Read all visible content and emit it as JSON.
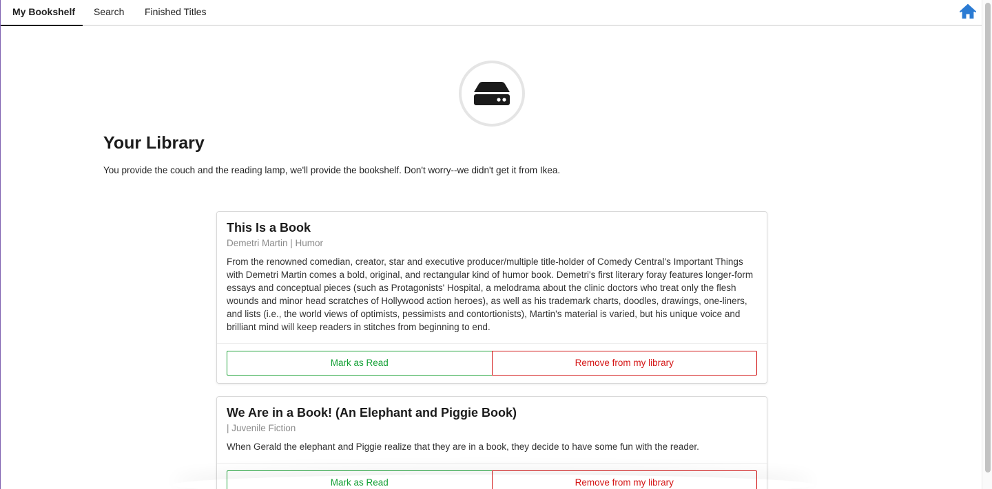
{
  "nav": {
    "tabs": [
      {
        "label": "My Bookshelf",
        "active": true
      },
      {
        "label": "Search",
        "active": false
      },
      {
        "label": "Finished Titles",
        "active": false
      }
    ],
    "home_icon": "home-icon"
  },
  "hero": {
    "icon": "hard-drive-icon",
    "title": "Your Library",
    "subtitle": "You provide the couch and the reading lamp, we'll provide the bookshelf. Don't worry--we didn't get it from Ikea."
  },
  "books": [
    {
      "title": "This Is a Book",
      "meta": "Demetri Martin | Humor",
      "description": "From the renowned comedian, creator, star and executive producer/multiple title-holder of Comedy Central's Important Things with Demetri Martin comes a bold, original, and rectangular kind of humor book. Demetri's first literary foray features longer-form essays and conceptual pieces (such as Protagonists' Hospital, a melodrama about the clinic doctors who treat only the flesh wounds and minor head scratches of Hollywood action heroes), as well as his trademark charts, doodles, drawings, one-liners, and lists (i.e., the world views of optimists, pessimists and contortionists), Martin's material is varied, but his unique voice and brilliant mind will keep readers in stitches from beginning to end.",
      "mark_read_label": "Mark as Read",
      "remove_label": "Remove from my library"
    },
    {
      "title": "We Are in a Book! (An Elephant and Piggie Book)",
      "meta": "| Juvenile Fiction",
      "description": "When Gerald the elephant and Piggie realize that they are in a book, they decide to have some fun with the reader.",
      "mark_read_label": "Mark as Read",
      "remove_label": "Remove from my library"
    }
  ],
  "colors": {
    "accent_home": "#2b7bd3",
    "mark_read": "#13a035",
    "remove": "#d41414"
  }
}
